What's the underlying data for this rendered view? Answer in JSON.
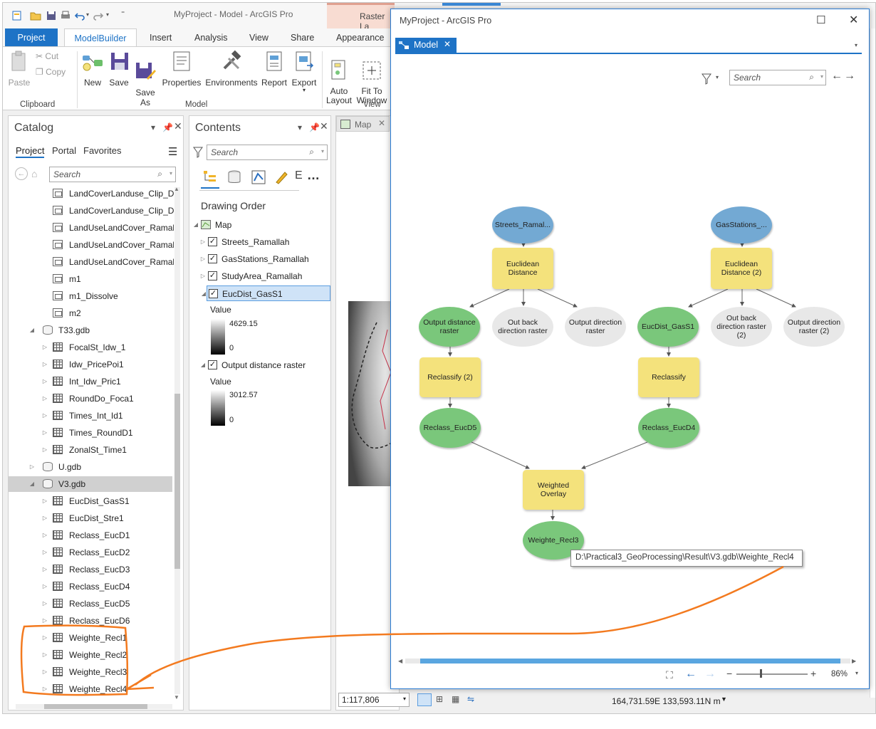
{
  "app": {
    "title": "MyProject - Model - ArcGIS Pro",
    "raster_context_tab": "Raster La",
    "ribbon_tabs": [
      "Project",
      "ModelBuilder",
      "Insert",
      "Analysis",
      "View",
      "Share",
      "Appearance"
    ],
    "clipboard": {
      "paste": "Paste",
      "cut": "Cut",
      "copy": "Copy",
      "group": "Clipboard"
    },
    "model_group": {
      "new": "New",
      "save": "Save",
      "save_as": "Save\nAs",
      "properties": "Properties",
      "environments": "Environments",
      "report": "Report",
      "export": "Export",
      "group": "Model"
    },
    "view_group": {
      "auto_layout": "Auto\nLayout",
      "fit_window": "Fit To\nWindow",
      "group": "View"
    }
  },
  "catalog": {
    "title": "Catalog",
    "tabs": [
      "Project",
      "Portal",
      "Favorites"
    ],
    "search_placeholder": "Search",
    "items": [
      {
        "label": "LandCoverLanduse_Clip_Di",
        "type": "file",
        "indent": 2
      },
      {
        "label": "LandCoverLanduse_Clip_Di",
        "type": "file",
        "indent": 2
      },
      {
        "label": "LandUseLandCover_Ramall",
        "type": "file",
        "indent": 2
      },
      {
        "label": "LandUseLandCover_Ramall",
        "type": "file",
        "indent": 2
      },
      {
        "label": "LandUseLandCover_Ramall",
        "type": "file",
        "indent": 2
      },
      {
        "label": "m1",
        "type": "file",
        "indent": 2
      },
      {
        "label": "m1_Dissolve",
        "type": "file",
        "indent": 2
      },
      {
        "label": "m2",
        "type": "file",
        "indent": 2
      },
      {
        "label": "T33.gdb",
        "type": "gdb",
        "indent": 1,
        "expanded": true
      },
      {
        "label": "FocalSt_Idw_1",
        "type": "raster",
        "indent": 2
      },
      {
        "label": "Idw_PricePoi1",
        "type": "raster",
        "indent": 2
      },
      {
        "label": "Int_Idw_Pric1",
        "type": "raster",
        "indent": 2
      },
      {
        "label": "RoundDo_Foca1",
        "type": "raster",
        "indent": 2
      },
      {
        "label": "Times_Int_Id1",
        "type": "raster",
        "indent": 2
      },
      {
        "label": "Times_RoundD1",
        "type": "raster",
        "indent": 2
      },
      {
        "label": "ZonalSt_Time1",
        "type": "raster",
        "indent": 2
      },
      {
        "label": "U.gdb",
        "type": "gdb",
        "indent": 1,
        "expanded": false
      },
      {
        "label": "V3.gdb",
        "type": "gdb",
        "indent": 1,
        "expanded": true,
        "selected": true
      },
      {
        "label": "EucDist_GasS1",
        "type": "raster",
        "indent": 2
      },
      {
        "label": "EucDist_Stre1",
        "type": "raster",
        "indent": 2
      },
      {
        "label": "Reclass_EucD1",
        "type": "raster",
        "indent": 2
      },
      {
        "label": "Reclass_EucD2",
        "type": "raster",
        "indent": 2
      },
      {
        "label": "Reclass_EucD3",
        "type": "raster",
        "indent": 2
      },
      {
        "label": "Reclass_EucD4",
        "type": "raster",
        "indent": 2
      },
      {
        "label": "Reclass_EucD5",
        "type": "raster",
        "indent": 2
      },
      {
        "label": "Reclass_EucD6",
        "type": "raster",
        "indent": 2
      },
      {
        "label": "Weighte_Recl1",
        "type": "raster",
        "indent": 2
      },
      {
        "label": "Weighte_Recl2",
        "type": "raster",
        "indent": 2
      },
      {
        "label": "Weighte_Recl3",
        "type": "raster",
        "indent": 2
      },
      {
        "label": "Weighte_Recl4",
        "type": "raster",
        "indent": 2
      }
    ]
  },
  "contents": {
    "title": "Contents",
    "search_placeholder": "Search",
    "drawing_order": "Drawing Order",
    "map": "Map",
    "layers": [
      "Streets_Ramallah",
      "GasStations_Ramallah",
      "StudyArea_Ramallah",
      "EucDist_GasS1"
    ],
    "value_label": "Value",
    "eucdist_max": "4629.15",
    "eucdist_min": "0",
    "output_layer": "Output distance raster",
    "output_max": "3012.57",
    "output_min": "0"
  },
  "mapview": {
    "tab": "Map"
  },
  "status": {
    "scale": "1:117,806",
    "coords": "164,731.59E 133,593.11N m"
  },
  "model": {
    "window_title": "MyProject - ArcGIS Pro",
    "tab": "Model",
    "search_placeholder": "Search",
    "zoom": "86%",
    "nodes": {
      "streets": "Streets_Ramal...",
      "gas": "GasStations_...",
      "euc1": "Euclidean Distance",
      "euc2": "Euclidean Distance (2)",
      "out_dist": "Output distance raster",
      "out_back": "Out back direction raster",
      "out_dir": "Output direction raster",
      "eucdist_gas": "EucDist_GasS1",
      "out_back2": "Out back direction raster (2)",
      "out_dir2": "Output direction raster (2)",
      "reclass2": "Reclassify (2)",
      "reclass": "Reclassify",
      "reclass_d5": "Reclass_EucD5",
      "reclass_d4": "Reclass_EucD4",
      "weighted": "Weighted Overlay",
      "weighte_recl3": "Weighte_Recl3"
    },
    "tooltip": "D:\\Practical3_GeoProcessing\\Result\\V3.gdb\\Weighte_Recl4"
  }
}
